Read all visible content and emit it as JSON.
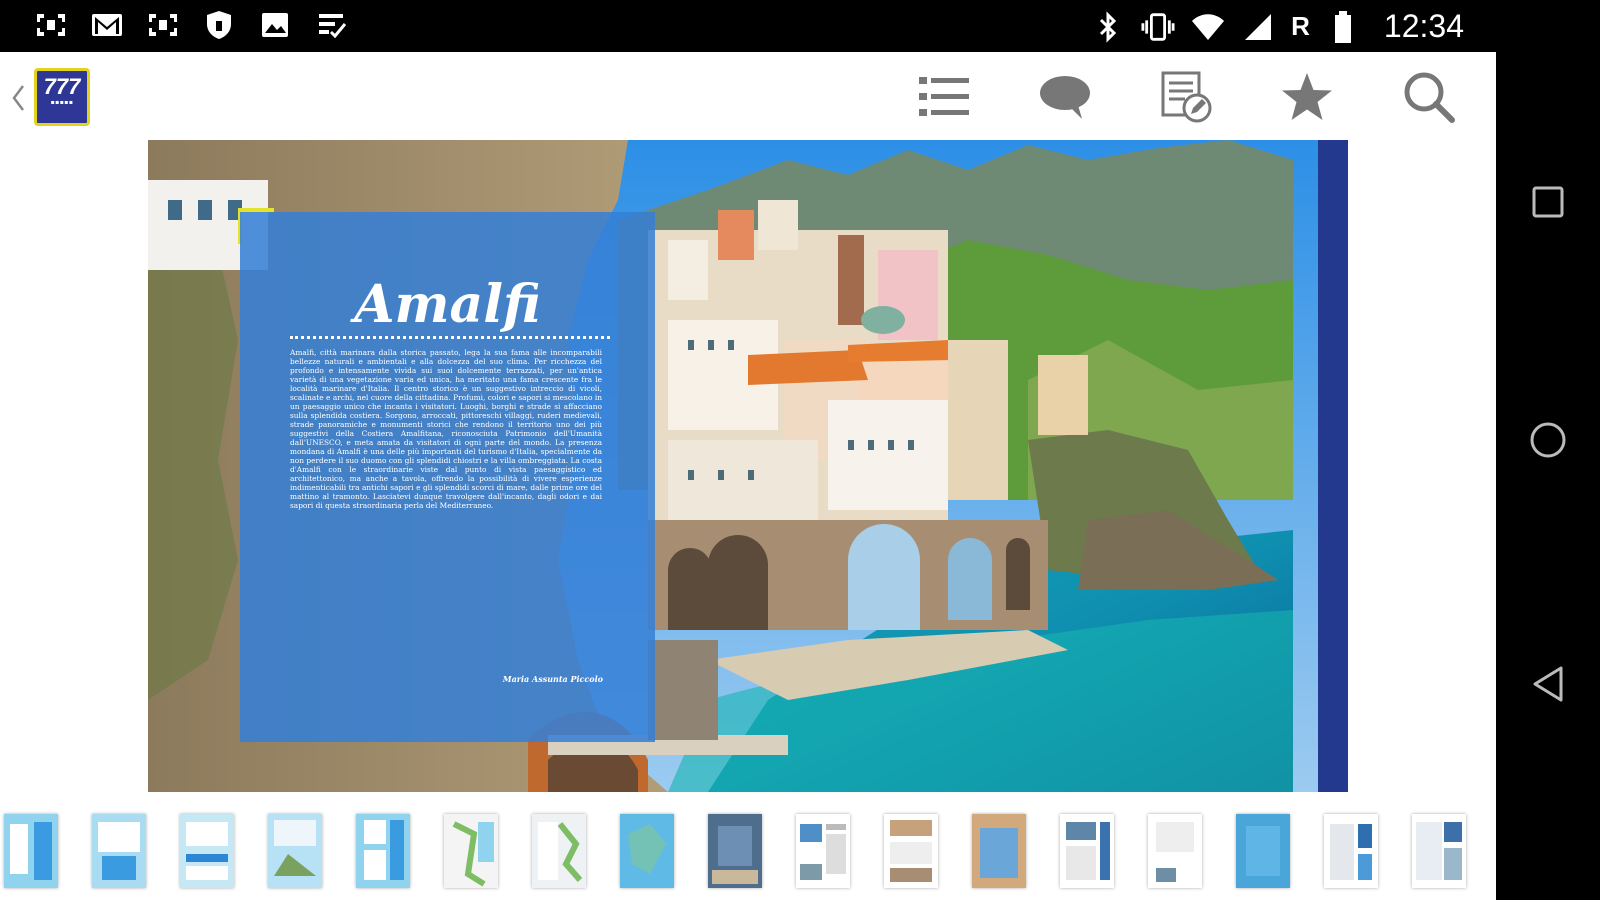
{
  "status_bar": {
    "left_icons": [
      "kaspersky-icon",
      "gmail-icon",
      "kaspersky-icon",
      "shield-icon",
      "image-icon",
      "checklist-icon"
    ],
    "right_icons": [
      "bluetooth-icon",
      "vibrate-icon",
      "wifi-icon",
      "signal-icon"
    ],
    "roaming": "R",
    "battery": "battery-icon",
    "time": "12:34"
  },
  "app": {
    "logo_text": "777",
    "toolbar_icons": [
      "list-icon",
      "comment-icon",
      "edit-note-icon",
      "star-icon",
      "search-icon"
    ]
  },
  "article": {
    "title": "Amalfi",
    "body": "Amalfi, città marinara dalla storica passato, lega la sua fama alle incomparabili bellezze naturali e ambientali e alla dolcezza del suo clima. Per ricchezza del profondo e intensamente vivida sui suoi dolcemente terrazzati, per un'antica varietà di una vegetazione varia ed unica, ha meritato una fama crescente fra le località marinare d'Italia. Il centro storico è un suggestivo intreccio di vicoli, scalinate e archi, nel cuore della cittadina. Profumi, colori e sapori si mescolano in un paesaggio unico che incanta i visitatori. Luoghi, borghi e strade si affacciano sulla splendida costiera.\nSorgono, arroccati, pittoreschi villaggi, ruderi medievali, strade panoramiche e monumenti storici che rendono il territorio uno dei più suggestivi della Costiera Amalfitana, riconosciuta Patrimonio dell'Umanità dall'UNESCO, e meta amata da visitatori di ogni parte del mondo.\nLa presenza mondana di Amalfi è una delle più importanti del turismo d'Italia, specialmente da non perdere il suo duomo con gli splendidi chiostri e la villa ombreggiata.\nLa costa d'Amalfi con le straordinarie viste dal punto di vista paesaggistico ed architettonico, ma anche a tavola, offrendo la possibilità di vivere esperienze indimenticabili tra antichi sapori e gli splendidi scorci di mare, dalle prime ore del mattino al tramonto.\nLasciatevi dunque travolgere dall'incanto, dagli odori e dai sapori di questa straordinaria perla del Mediterraneo.",
    "author": "Maria Assunta Piccolo"
  },
  "thumbnails": [
    {
      "name": "page-thumb-1"
    },
    {
      "name": "page-thumb-2"
    },
    {
      "name": "page-thumb-3"
    },
    {
      "name": "page-thumb-4"
    },
    {
      "name": "page-thumb-5"
    },
    {
      "name": "page-thumb-6"
    },
    {
      "name": "page-thumb-7"
    },
    {
      "name": "page-thumb-8"
    },
    {
      "name": "page-thumb-9"
    },
    {
      "name": "page-thumb-10"
    },
    {
      "name": "page-thumb-11"
    },
    {
      "name": "page-thumb-12"
    },
    {
      "name": "page-thumb-13"
    },
    {
      "name": "page-thumb-14"
    },
    {
      "name": "page-thumb-15"
    },
    {
      "name": "page-thumb-16"
    },
    {
      "name": "page-thumb-17"
    }
  ],
  "nav_buttons": [
    "recents-button",
    "home-button",
    "back-button"
  ],
  "colors": {
    "accent_blue": "#347fd6",
    "spine_blue": "#23398e",
    "logo_blue": "#2f3796",
    "logo_yellow": "#e3d31c",
    "toolbar_icon_gray": "#777777"
  }
}
